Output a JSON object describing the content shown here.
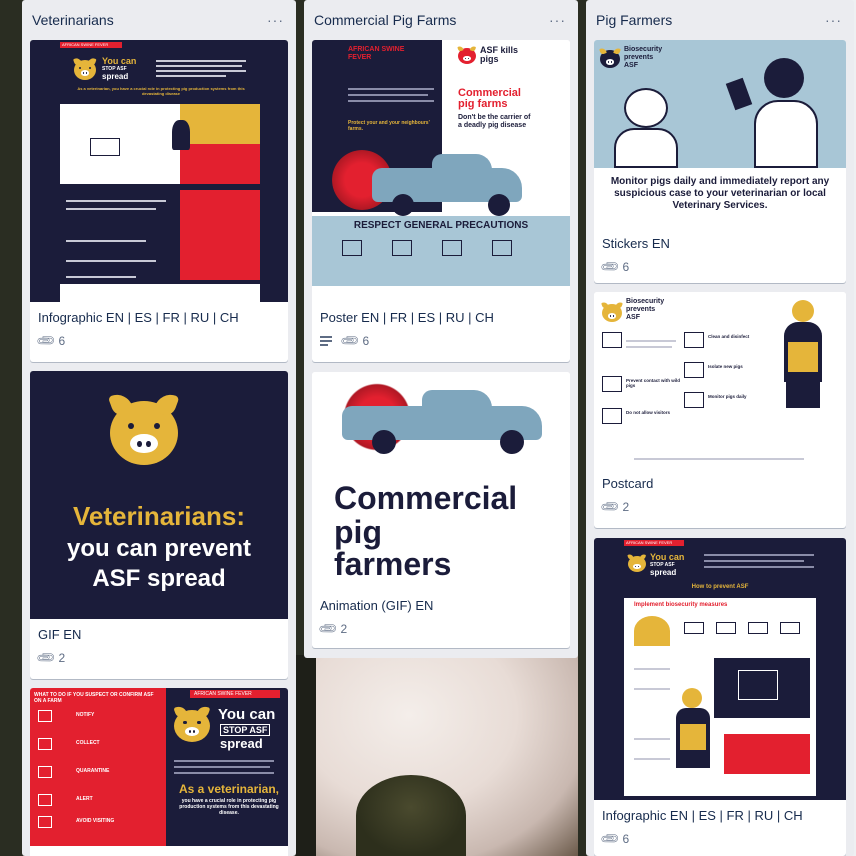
{
  "lists": [
    {
      "title": "Veterinarians",
      "menu": "···",
      "cards": [
        {
          "title": "Infographic EN | ES | FR | RU | CH",
          "attachments": "6",
          "cover_text": [
            "AFRICAN SWINE FEVER",
            "You can",
            "STOP ASF",
            "spread",
            "As a veterinarian, you have a crucial role in protecting pig production systems from this devastating disease"
          ]
        },
        {
          "title": "GIF EN",
          "attachments": "2",
          "cover_text": [
            "Veterinarians:",
            "you can prevent",
            "ASF spread"
          ]
        },
        {
          "title": "",
          "attachments": "",
          "cover_text": [
            "WHAT TO DO IF YOU SUSPECT OR CONFIRM ASF ON A FARM",
            "AFRICAN SWINE FEVER",
            "You can",
            "STOP ASF",
            "spread",
            "NOTIFY",
            "COLLECT",
            "QUARANTINE",
            "ALERT",
            "AVOID VISITING",
            "As a veterinarian,",
            "you have a crucial role in protecting pig production systems from this devastating disease."
          ]
        }
      ]
    },
    {
      "title": "Commercial Pig Farms",
      "menu": "···",
      "cards": [
        {
          "title": "Poster EN | FR | ES | RU | CH",
          "attachments": "6",
          "cover_text": [
            "AFRICAN SWINE FEVER",
            "ASF kills pigs",
            "Commercial pig farms",
            "Don't be the carrier of a deadly pig disease",
            "Protect your and your neighbours' farms.",
            "RESPECT GENERAL PRECAUTIONS"
          ]
        },
        {
          "title": "Animation (GIF) EN",
          "attachments": "2",
          "cover_text": [
            "Commercial",
            "pig",
            "farmers"
          ]
        }
      ]
    },
    {
      "title": "Pig Farmers",
      "menu": "···",
      "cards": [
        {
          "title": "Stickers EN",
          "attachments": "6",
          "cover_text": [
            "Biosecurity prevents ASF",
            "Monitor pigs daily and immediately report any suspicious case to your veterinarian or local Veterinary Services."
          ]
        },
        {
          "title": "Postcard",
          "attachments": "2",
          "cover_text": [
            "Biosecurity prevents ASF",
            "Clean and disinfect",
            "Isolate new pigs",
            "Prevent contact with wild pigs",
            "Monitor pigs daily",
            "Do not allow visitors"
          ]
        },
        {
          "title": "Infographic EN | ES | FR | RU | CH",
          "attachments": "6",
          "cover_text": [
            "AFRICAN SWINE FEVER",
            "You can",
            "STOP ASF",
            "spread",
            "How to prevent ASF",
            "Implement biosecurity measures"
          ]
        }
      ]
    }
  ],
  "colors": {
    "navy": "#1b1c3a",
    "red": "#e3202f",
    "yellow": "#e5b53a",
    "list_bg": "#ebecf0",
    "text": "#172b4d"
  }
}
